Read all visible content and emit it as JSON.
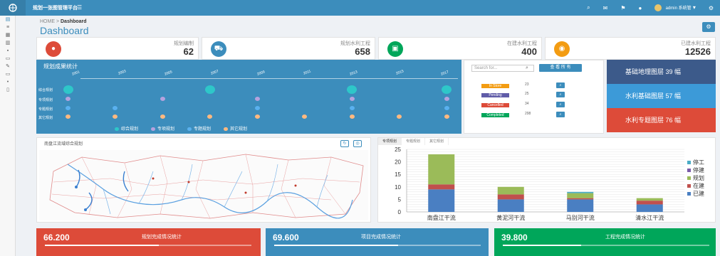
{
  "app": {
    "title": "规划一张图管理平台"
  },
  "breadcrumb": {
    "home": "HOME",
    "sep": ">",
    "current": "Dashboard"
  },
  "page_title": "Dashboard",
  "user": {
    "name": "admin 系统管"
  },
  "stats": [
    {
      "label": "规划编制",
      "value": "62",
      "color": "#dd4b39",
      "icon": "person-icon"
    },
    {
      "label": "规划水利工程",
      "value": "658",
      "color": "#3c8dbc",
      "icon": "cart-icon"
    },
    {
      "label": "在建水利工程",
      "value": "400",
      "color": "#00a65a",
      "icon": "money-icon"
    },
    {
      "label": "已建水利工程",
      "value": "12526",
      "color": "#f39c12",
      "icon": "eye-icon"
    }
  ],
  "plan_panel": {
    "title": "规划成果统计",
    "years": [
      "2001",
      "2003",
      "2005",
      "2007",
      "2009",
      "2011",
      "2013",
      "2015",
      "2017"
    ],
    "rows": [
      "综合规划",
      "专项规划",
      "专题规划",
      "其它规划"
    ],
    "legend": [
      {
        "label": "综合规划",
        "color": "#2ec7c9"
      },
      {
        "label": "专项规划",
        "color": "#b6a2de"
      },
      {
        "label": "专题规划",
        "color": "#5ab1ef"
      },
      {
        "label": "其它规划",
        "color": "#ffb980"
      }
    ]
  },
  "status_panel": {
    "search_placeholder": "Search for...",
    "query_label": "查 看 所 有",
    "rows": [
      {
        "tag": "In Store",
        "color": "#f39c12",
        "num": "23"
      },
      {
        "tag": "Pending",
        "color": "#605ca8",
        "num": "25"
      },
      {
        "tag": "Cancelled",
        "color": "#dd4b39",
        "num": "34"
      },
      {
        "tag": "Completed",
        "color": "#00a65a",
        "num": "298"
      }
    ]
  },
  "tiles": [
    {
      "label": "基础地理图层 39 幅",
      "color": "#3c5a8a"
    },
    {
      "label": "水利基础图层 57 幅",
      "color": "#3c9ad8"
    },
    {
      "label": "水利专题图层 76 幅",
      "color": "#dd4b39"
    }
  ],
  "map_panel": {
    "title": "南盘江流域综合规划"
  },
  "chart_tabs": [
    "专项规划",
    "专题规划",
    "其它规划"
  ],
  "chart_data": {
    "type": "bar",
    "stacked": true,
    "categories": [
      "南盘江干流",
      "黄泥河干流",
      "马别河干流",
      "清水江干流"
    ],
    "ylim": [
      0,
      25
    ],
    "yticks": [
      0,
      5,
      10,
      15,
      20,
      25
    ],
    "legend_position": "right",
    "series": [
      {
        "name": "已建",
        "color": "#4a7fc2",
        "values": [
          9,
          5,
          5,
          3
        ]
      },
      {
        "name": "在建",
        "color": "#c0504d",
        "values": [
          2,
          2,
          0.5,
          1.5
        ]
      },
      {
        "name": "规划",
        "color": "#9bbb59",
        "values": [
          12,
          3,
          2,
          1
        ]
      },
      {
        "name": "停建",
        "color": "#7a5ba8",
        "values": [
          0,
          0,
          0,
          0
        ]
      },
      {
        "name": "停工",
        "color": "#4bacc6",
        "values": [
          0,
          0,
          0.5,
          0
        ]
      }
    ]
  },
  "metrics": [
    {
      "value": "66.200",
      "label": "规划完成情况统计",
      "color": "#dd4b39",
      "fill": 0.55
    },
    {
      "value": "69.600",
      "label": "项目完成情况统计",
      "color": "#3c8dbc",
      "fill": 0.6
    },
    {
      "value": "39.800",
      "label": "工程完成情况统计",
      "color": "#00a65a",
      "fill": 0.38
    }
  ]
}
